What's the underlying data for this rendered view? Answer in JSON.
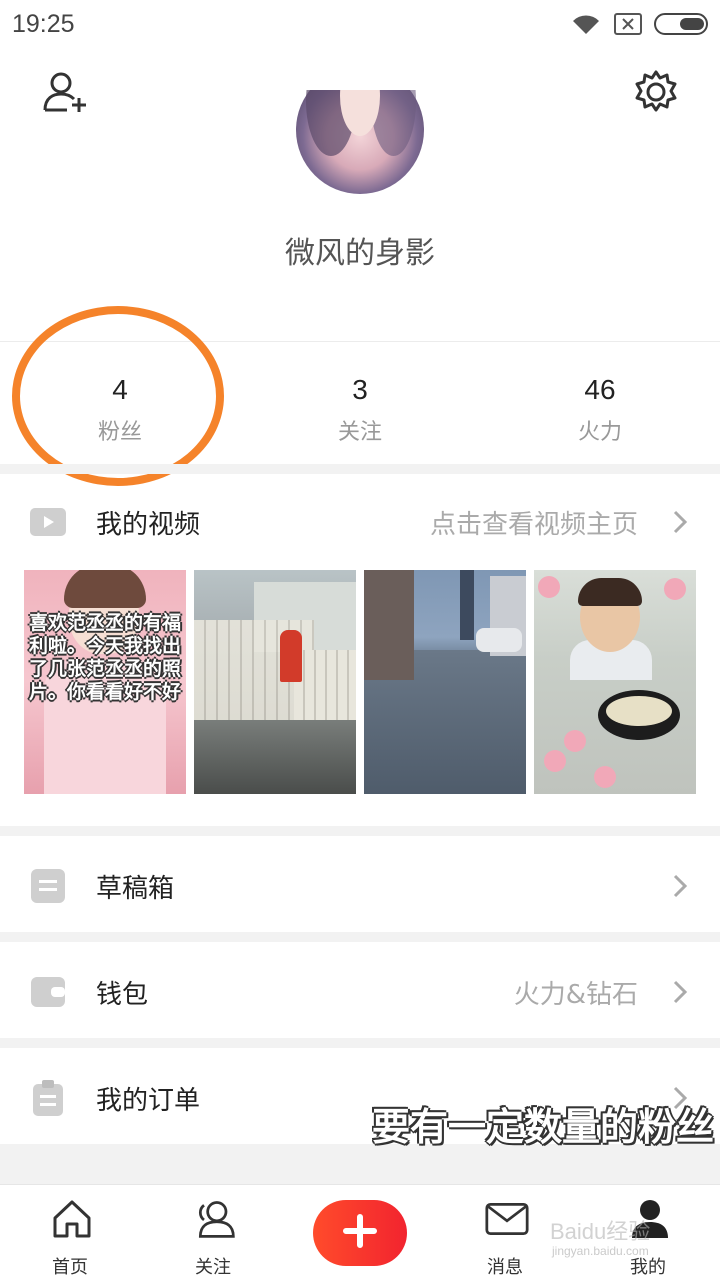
{
  "status_bar": {
    "time": "19:25",
    "icons": [
      "wifi-icon",
      "sim-blocked-icon",
      "battery-icon"
    ]
  },
  "header": {
    "add_friend_icon": "person-add-icon",
    "settings_icon": "gear-icon"
  },
  "profile": {
    "username": "微风的身影"
  },
  "stats": [
    {
      "value": "4",
      "label": "粉丝"
    },
    {
      "value": "3",
      "label": "关注"
    },
    {
      "value": "46",
      "label": "火力"
    }
  ],
  "videos": {
    "title": "我的视频",
    "hint": "点击查看视频主页",
    "thumbnails": [
      {
        "caption": "喜欢范丞丞的有福利啦。今天我找出了几张范丞丞的照片。你看看好不好"
      },
      {
        "caption": ""
      },
      {
        "caption": ""
      },
      {
        "caption": ""
      }
    ]
  },
  "menu": [
    {
      "title": "草稿箱",
      "hint": ""
    },
    {
      "title": "钱包",
      "hint": "火力&钻石"
    },
    {
      "title": "我的订单",
      "hint": ""
    }
  ],
  "tabbar": [
    {
      "label": "首页",
      "icon": "home-icon"
    },
    {
      "label": "关注",
      "icon": "friends-icon"
    },
    {
      "label": "",
      "icon": "plus-icon"
    },
    {
      "label": "消息",
      "icon": "mail-icon"
    },
    {
      "label": "我的",
      "icon": "profile-icon"
    }
  ],
  "overlay": {
    "caption": "要有一定数量的粉丝",
    "watermark": "Baidu经验",
    "watermark_url": "jingyan.baidu.com"
  },
  "colors": {
    "accent": "#f5832a",
    "fab": "#f2242f"
  }
}
